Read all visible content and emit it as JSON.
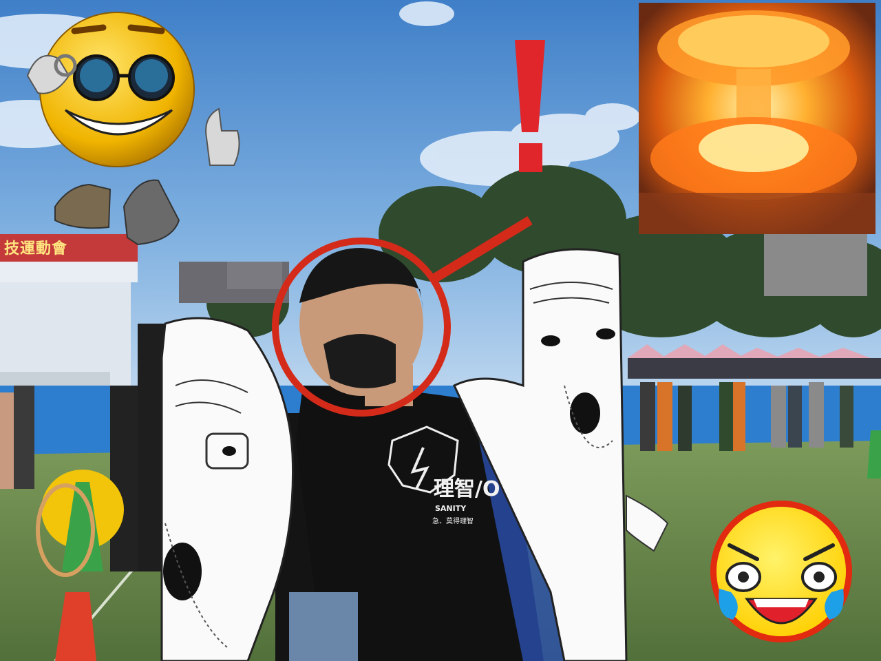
{
  "banner": {
    "text": "技運動會"
  },
  "shirt": {
    "main": "理智/O",
    "sub": "SANITY",
    "small": "急、莫得理智"
  },
  "stickers": {
    "cool_face": "sunglasses-thumbs-up-emoji",
    "exclamation": "!",
    "explosion": "nuclear-mushroom-cloud",
    "laughing_face": "tears-of-joy-emoji",
    "wojaks": "bearded-wojak-faces"
  },
  "colors": {
    "sky": "#5e9ad8",
    "grass": "#6f8e4a",
    "track": "#2e7ed0",
    "highlight_circle": "#d42a1a",
    "exclamation": "#e0262a"
  }
}
